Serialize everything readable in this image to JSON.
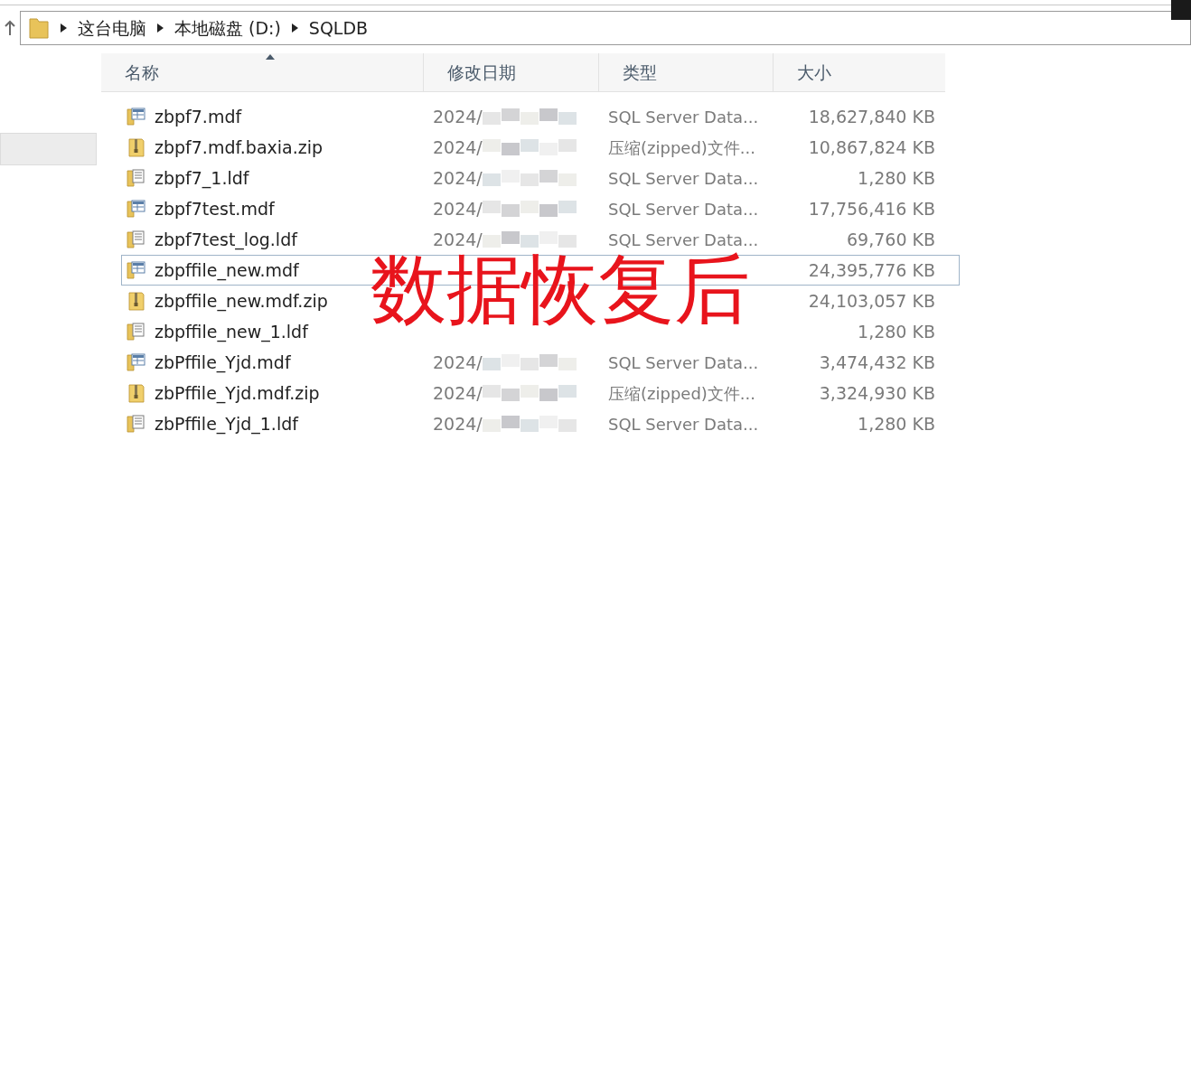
{
  "breadcrumb": [
    "这台电脑",
    "本地磁盘 (D:)",
    "SQLDB"
  ],
  "columns": [
    {
      "label": "名称",
      "sorted": true
    },
    {
      "label": "修改日期",
      "sorted": false
    },
    {
      "label": "类型",
      "sorted": false
    },
    {
      "label": "大小",
      "sorted": false
    }
  ],
  "rows": [
    {
      "kind": "mdf",
      "name": "zbpf7.mdf",
      "date": "2024/",
      "type": "SQL Server Data...",
      "size": "18,627,840 KB",
      "selected": false
    },
    {
      "kind": "zip",
      "name": "zbpf7.mdf.baxia.zip",
      "date": "2024/",
      "type": "压缩(zipped)文件...",
      "size": "10,867,824 KB",
      "selected": false
    },
    {
      "kind": "ldf",
      "name": "zbpf7_1.ldf",
      "date": "2024/",
      "type": "SQL Server Data...",
      "size": "1,280 KB",
      "selected": false
    },
    {
      "kind": "mdf",
      "name": "zbpf7test.mdf",
      "date": "2024/",
      "type": "SQL Server Data...",
      "size": "17,756,416 KB",
      "selected": false
    },
    {
      "kind": "ldf",
      "name": "zbpf7test_log.ldf",
      "date": "2024/",
      "type": "SQL Server Data...",
      "size": "69,760 KB",
      "selected": false
    },
    {
      "kind": "mdf",
      "name": "zbpffile_new.mdf",
      "size": "24,395,776 KB",
      "selected": true
    },
    {
      "kind": "zip",
      "name": "zbpffile_new.mdf.zip",
      "size": "24,103,057 KB",
      "selected": false
    },
    {
      "kind": "ldf",
      "name": "zbpffile_new_1.ldf",
      "size": "1,280 KB",
      "selected": false
    },
    {
      "kind": "mdf",
      "name": "zbPffile_Yjd.mdf",
      "date": "2024/",
      "type": "SQL Server Data...",
      "size": "3,474,432 KB",
      "selected": false
    },
    {
      "kind": "zip",
      "name": "zbPffile_Yjd.mdf.zip",
      "date": "2024/",
      "type": "压缩(zipped)文件...",
      "size": "3,324,930 KB",
      "selected": false
    },
    {
      "kind": "ldf",
      "name": "zbPffile_Yjd_1.ldf",
      "date": "2024/",
      "type": "SQL Server Data...",
      "size": "1,280 KB",
      "selected": false
    }
  ],
  "annotation": "数据恢复后"
}
